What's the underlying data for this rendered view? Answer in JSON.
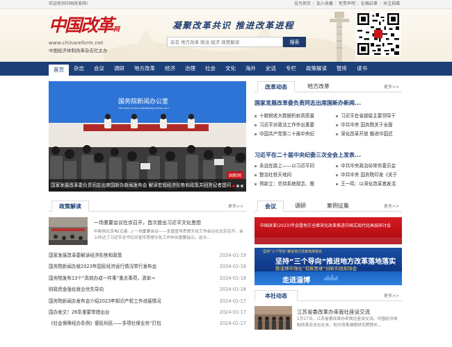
{
  "topbar": {
    "welcome": "欢迎来到中国改革网!",
    "links": [
      "设为首页",
      "加入收藏",
      "免责声明",
      "征稿启事",
      "关注捐赠"
    ]
  },
  "header": {
    "logo_mark": "中国改革",
    "logo_mark_small": "网",
    "logo_url": "www.chinareform.net",
    "logo_sub": "中国经济体制改革杂志社主办",
    "slogan": "凝聚改革共识 推进改革进程",
    "search_placeholder": "杂志 地方改革 政治 经济 政策解读",
    "search_button": "搜索"
  },
  "nav": {
    "items": [
      "首页",
      "杂志",
      "会议",
      "调研",
      "地方改革",
      "经济",
      "治理",
      "社会",
      "文化",
      "海外",
      "史话",
      "专栏",
      "政策解读",
      "智库",
      "读书"
    ]
  },
  "slider": {
    "caption": "国家发展改革委负责同志出席国新办新闻发布会 解读宏观经济形势和政策并回答记者提问",
    "badge": "国新网",
    "board_title": "国务院新闻办公室",
    "board_subtitle": "THE STATE COUNCIL INFORMATION OFFICE, P.R.C."
  },
  "reform_news": {
    "tab_active": "改革动态",
    "tab_other": "地方改革",
    "more": "更多>>",
    "headline1": "国家发展改革委负责同志出席国新办新闻...",
    "list1": [
      "十歇税收大数据析射高质量",
      "习近平在省部级主要领导干",
      "习近平对政法工作作出重要",
      "中共中央 国务院关于全面",
      "中国共产党第二十届中央纪",
      "深化改革开放 推进中国式"
    ],
    "headline2": "习近平在二十届中央纪委三次全会上发表...",
    "list2": [
      "永远在路上——以习近平同",
      "中共中央政治局常务委员会",
      "整治社校天地间",
      "中共中央 国务院印发《关于",
      "郑新立：坚持系统观念、推",
      "王一鸣：以深化改革激发活"
    ]
  },
  "policy": {
    "tab": "政策解读",
    "more": "更多>>",
    "feature_title": "一场重要会议在京召开，首次提出习近平文化思想",
    "feature_desc": "中新网北京电(记者 ..) 一场重要会议——全国宣传思想文化工作会议在北京召开。会上传达了习近平总书记对宣传思想文化工作作出重要指示。这次...",
    "items": [
      {
        "title": "国家发展改革委解读经济形势和政策",
        "date": "2024-01-19"
      },
      {
        "title": "国务院新闻办就2023年国民经济运行情况举行发布会",
        "date": "2024-01-18"
      },
      {
        "title": "国务院发布13个“高效办成一件事”重点事项，清单→",
        "date": "2024-01-18"
      },
      {
        "title": "财政资金强化就业优先导向",
        "date": "2024-01-18"
      },
      {
        "title": "国务院新闻办发布会介绍2023年知识产权工作进展情况",
        "date": "2024-01-17"
      },
      {
        "title": "国办发文！26条重要举措出台",
        "date": "2024-01-17"
      },
      {
        "title": "《社会保障经办条例》便民利民——多项社保业务“打包",
        "date": "2024-01-17"
      }
    ]
  },
  "meeting": {
    "tabs": [
      "会议",
      "调研",
      "案例征集"
    ],
    "more": "更多>>",
    "banner1_text": "中国改革(2023)年会暨地方全面深化改革推进中国式现代化高层研讨会",
    "banner2_top": "坚持“三个导向”推进地方改革落地落实",
    "banner2_title": "坚持“三个导向”推进地方改革落地落实",
    "banner2_sub": "暨淄博市强化“有解思维”创新实践现场会",
    "banner3_title": "走进淄博"
  },
  "local_news": {
    "tab": "本社动态",
    "more": "更多>>",
    "title": "江苏省委改革办来我社座谈交流",
    "desc": "1月17日，江苏省委改革办来我社座谈交流。中国经济体制改革杂志社社长、地方改革课题研究院院长..."
  },
  "colors": {
    "nav_bg": "#1c3f78",
    "brand_red": "#c8161d",
    "headline_blue": "#1c3f78"
  }
}
